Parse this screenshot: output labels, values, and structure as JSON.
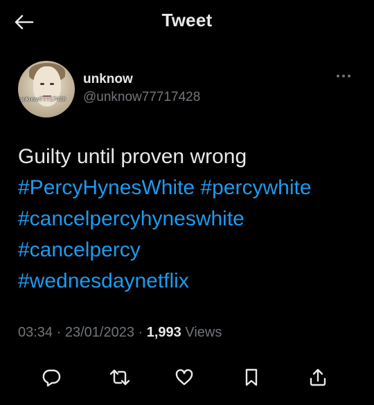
{
  "header": {
    "title": "Tweet",
    "back_icon": "arrow-left-icon"
  },
  "author": {
    "display_name": "unknow",
    "handle": "@unknow77717428",
    "avatar_watermark": "unknow77717428",
    "more_icon": "ellipsis-icon"
  },
  "tweet": {
    "lines": [
      [
        {
          "text": "Guilty until proven wrong",
          "type": "text"
        }
      ],
      [
        {
          "text": "#PercyHynesWhite",
          "type": "hashtag"
        },
        {
          "text": " ",
          "type": "text"
        },
        {
          "text": "#percywhite",
          "type": "hashtag"
        }
      ],
      [
        {
          "text": "#cancelpercyhyneswhite",
          "type": "hashtag"
        }
      ],
      [
        {
          "text": "#cancelpercy",
          "type": "hashtag"
        }
      ],
      [
        {
          "text": "#wednesdaynetflix",
          "type": "hashtag"
        }
      ]
    ]
  },
  "meta": {
    "time": "03:34",
    "separator": " · ",
    "date": "23/01/2023",
    "views_count": "1,993",
    "views_label": "Views"
  },
  "actions": [
    {
      "name": "reply-button",
      "icon": "reply-icon"
    },
    {
      "name": "retweet-button",
      "icon": "retweet-icon"
    },
    {
      "name": "like-button",
      "icon": "heart-icon"
    },
    {
      "name": "bookmark-button",
      "icon": "bookmark-icon"
    },
    {
      "name": "share-button",
      "icon": "share-icon"
    }
  ],
  "colors": {
    "background": "#000000",
    "text_primary": "#e7e9ea",
    "text_secondary": "#71767b",
    "hashtag": "#1d9bf0"
  }
}
